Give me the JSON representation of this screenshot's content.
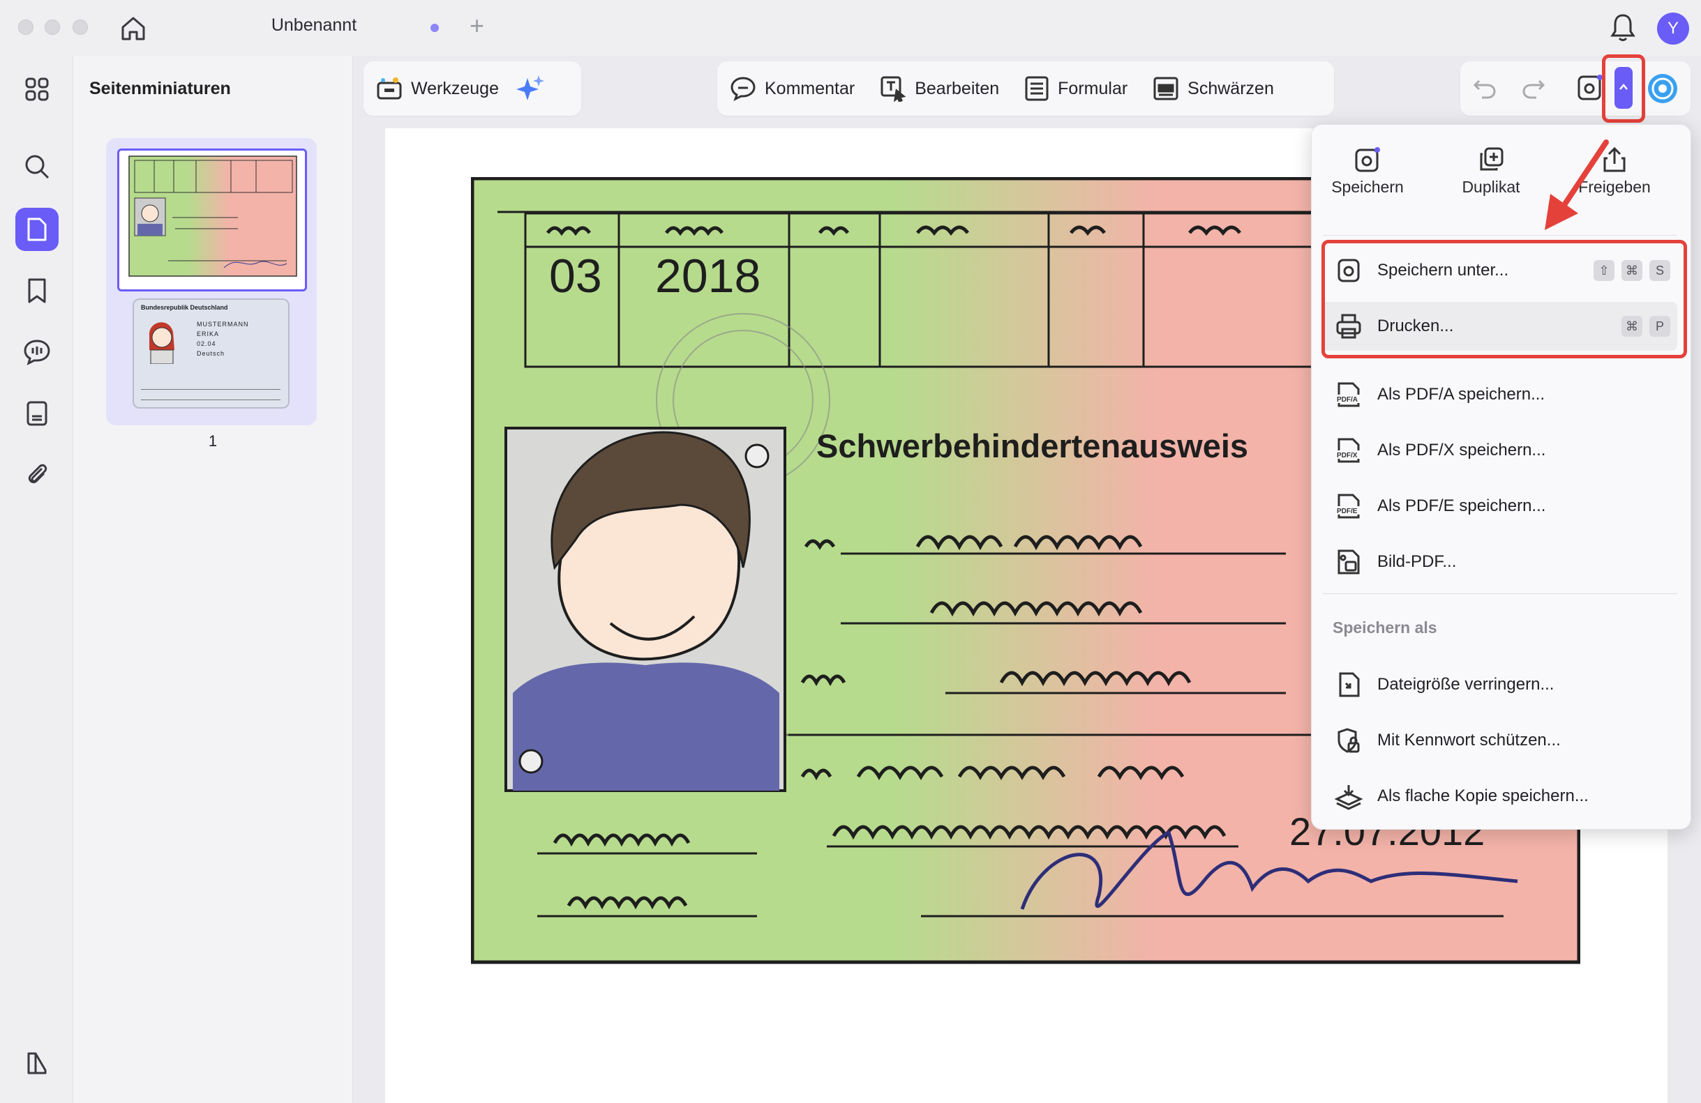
{
  "window": {
    "tab_title": "Unbenannt",
    "new_tab_symbol": "+",
    "avatar_initial": "Y"
  },
  "sidebar": {
    "panel_title": "Seitenminiaturen",
    "page_number": "1",
    "rail_icons": [
      "grid-icon",
      "search-icon",
      "page-icon",
      "bookmark-icon",
      "comment-icon",
      "form-icon",
      "attachment-icon",
      "panel-icon"
    ]
  },
  "toolbar": {
    "tools_label": "Werkzeuge",
    "comment_label": "Kommentar",
    "edit_label": "Bearbeiten",
    "form_label": "Formular",
    "redact_label": "Schwärzen"
  },
  "document": {
    "card_title": "Schwerbehindertenausweis",
    "month": "03",
    "year": "2018",
    "date": "27.07.2012",
    "thumb2_header": "Bundesrepublik Deutschland",
    "thumb2_lines": [
      "MUSTERMANN",
      "ERIKA",
      "02.04",
      "Deutsch"
    ]
  },
  "menu": {
    "top_actions": [
      {
        "label": "Speichern",
        "icon": "save-icon"
      },
      {
        "label": "Duplikat",
        "icon": "duplicate-icon"
      },
      {
        "label": "Freigeben",
        "icon": "share-icon"
      }
    ],
    "items": [
      {
        "label": "Speichern unter...",
        "icon": "save-as-icon",
        "shortcut": [
          "⇧",
          "⌘",
          "S"
        ]
      },
      {
        "label": "Drucken...",
        "icon": "print-icon",
        "shortcut": [
          "⌘",
          "P"
        ]
      },
      {
        "label": "Als PDF/A speichern...",
        "icon": "pdfa-icon"
      },
      {
        "label": "Als PDF/X speichern...",
        "icon": "pdfx-icon"
      },
      {
        "label": "Als PDF/E speichern...",
        "icon": "pdfe-icon"
      },
      {
        "label": "Bild-PDF...",
        "icon": "image-pdf-icon"
      }
    ],
    "section_label": "Speichern als",
    "section_items": [
      {
        "label": "Dateigröße verringern...",
        "icon": "compress-icon"
      },
      {
        "label": "Mit Kennwort schützen...",
        "icon": "password-icon"
      },
      {
        "label": "Als flache Kopie speichern...",
        "icon": "flatten-icon"
      }
    ]
  },
  "colors": {
    "accent": "#6a5cf6",
    "annotation_red": "#e5413b",
    "card_green": "#b6db8d",
    "card_red": "#f3b3a9"
  }
}
